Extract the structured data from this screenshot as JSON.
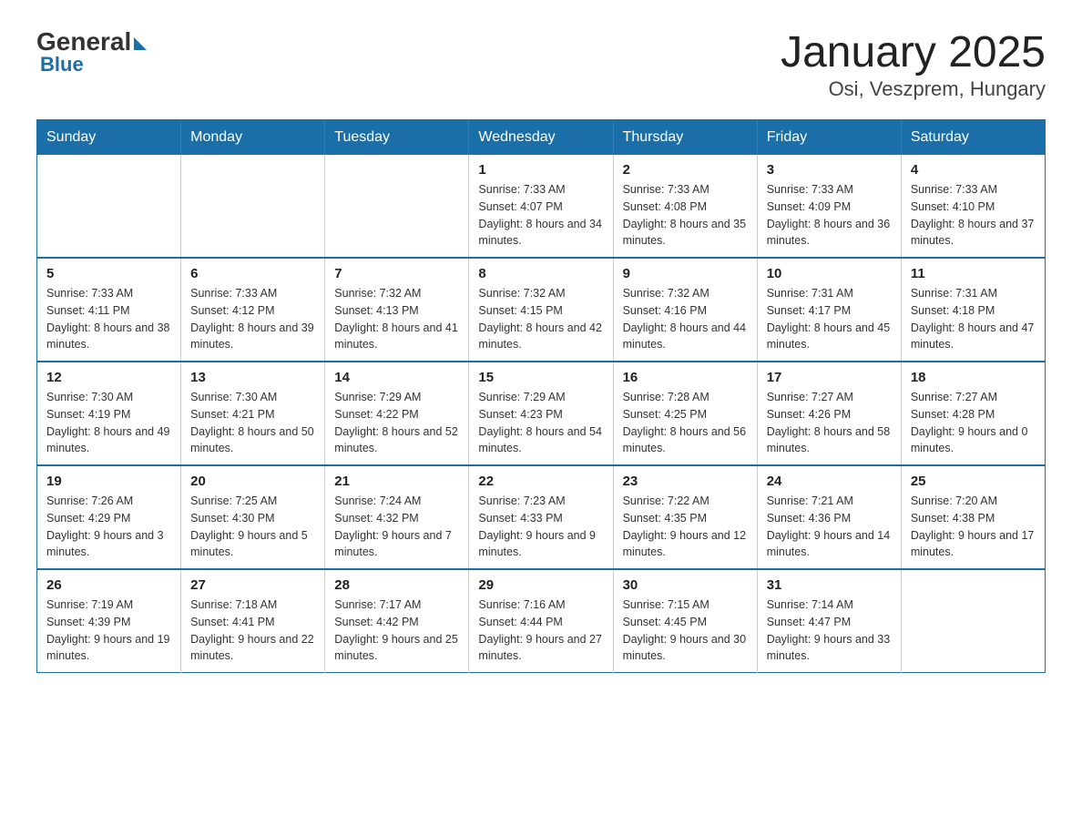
{
  "logo": {
    "general": "General",
    "blue": "Blue"
  },
  "title": "January 2025",
  "subtitle": "Osi, Veszprem, Hungary",
  "days_of_week": [
    "Sunday",
    "Monday",
    "Tuesday",
    "Wednesday",
    "Thursday",
    "Friday",
    "Saturday"
  ],
  "weeks": [
    [
      {
        "day": "",
        "info": ""
      },
      {
        "day": "",
        "info": ""
      },
      {
        "day": "",
        "info": ""
      },
      {
        "day": "1",
        "info": "Sunrise: 7:33 AM\nSunset: 4:07 PM\nDaylight: 8 hours\nand 34 minutes."
      },
      {
        "day": "2",
        "info": "Sunrise: 7:33 AM\nSunset: 4:08 PM\nDaylight: 8 hours\nand 35 minutes."
      },
      {
        "day": "3",
        "info": "Sunrise: 7:33 AM\nSunset: 4:09 PM\nDaylight: 8 hours\nand 36 minutes."
      },
      {
        "day": "4",
        "info": "Sunrise: 7:33 AM\nSunset: 4:10 PM\nDaylight: 8 hours\nand 37 minutes."
      }
    ],
    [
      {
        "day": "5",
        "info": "Sunrise: 7:33 AM\nSunset: 4:11 PM\nDaylight: 8 hours\nand 38 minutes."
      },
      {
        "day": "6",
        "info": "Sunrise: 7:33 AM\nSunset: 4:12 PM\nDaylight: 8 hours\nand 39 minutes."
      },
      {
        "day": "7",
        "info": "Sunrise: 7:32 AM\nSunset: 4:13 PM\nDaylight: 8 hours\nand 41 minutes."
      },
      {
        "day": "8",
        "info": "Sunrise: 7:32 AM\nSunset: 4:15 PM\nDaylight: 8 hours\nand 42 minutes."
      },
      {
        "day": "9",
        "info": "Sunrise: 7:32 AM\nSunset: 4:16 PM\nDaylight: 8 hours\nand 44 minutes."
      },
      {
        "day": "10",
        "info": "Sunrise: 7:31 AM\nSunset: 4:17 PM\nDaylight: 8 hours\nand 45 minutes."
      },
      {
        "day": "11",
        "info": "Sunrise: 7:31 AM\nSunset: 4:18 PM\nDaylight: 8 hours\nand 47 minutes."
      }
    ],
    [
      {
        "day": "12",
        "info": "Sunrise: 7:30 AM\nSunset: 4:19 PM\nDaylight: 8 hours\nand 49 minutes."
      },
      {
        "day": "13",
        "info": "Sunrise: 7:30 AM\nSunset: 4:21 PM\nDaylight: 8 hours\nand 50 minutes."
      },
      {
        "day": "14",
        "info": "Sunrise: 7:29 AM\nSunset: 4:22 PM\nDaylight: 8 hours\nand 52 minutes."
      },
      {
        "day": "15",
        "info": "Sunrise: 7:29 AM\nSunset: 4:23 PM\nDaylight: 8 hours\nand 54 minutes."
      },
      {
        "day": "16",
        "info": "Sunrise: 7:28 AM\nSunset: 4:25 PM\nDaylight: 8 hours\nand 56 minutes."
      },
      {
        "day": "17",
        "info": "Sunrise: 7:27 AM\nSunset: 4:26 PM\nDaylight: 8 hours\nand 58 minutes."
      },
      {
        "day": "18",
        "info": "Sunrise: 7:27 AM\nSunset: 4:28 PM\nDaylight: 9 hours\nand 0 minutes."
      }
    ],
    [
      {
        "day": "19",
        "info": "Sunrise: 7:26 AM\nSunset: 4:29 PM\nDaylight: 9 hours\nand 3 minutes."
      },
      {
        "day": "20",
        "info": "Sunrise: 7:25 AM\nSunset: 4:30 PM\nDaylight: 9 hours\nand 5 minutes."
      },
      {
        "day": "21",
        "info": "Sunrise: 7:24 AM\nSunset: 4:32 PM\nDaylight: 9 hours\nand 7 minutes."
      },
      {
        "day": "22",
        "info": "Sunrise: 7:23 AM\nSunset: 4:33 PM\nDaylight: 9 hours\nand 9 minutes."
      },
      {
        "day": "23",
        "info": "Sunrise: 7:22 AM\nSunset: 4:35 PM\nDaylight: 9 hours\nand 12 minutes."
      },
      {
        "day": "24",
        "info": "Sunrise: 7:21 AM\nSunset: 4:36 PM\nDaylight: 9 hours\nand 14 minutes."
      },
      {
        "day": "25",
        "info": "Sunrise: 7:20 AM\nSunset: 4:38 PM\nDaylight: 9 hours\nand 17 minutes."
      }
    ],
    [
      {
        "day": "26",
        "info": "Sunrise: 7:19 AM\nSunset: 4:39 PM\nDaylight: 9 hours\nand 19 minutes."
      },
      {
        "day": "27",
        "info": "Sunrise: 7:18 AM\nSunset: 4:41 PM\nDaylight: 9 hours\nand 22 minutes."
      },
      {
        "day": "28",
        "info": "Sunrise: 7:17 AM\nSunset: 4:42 PM\nDaylight: 9 hours\nand 25 minutes."
      },
      {
        "day": "29",
        "info": "Sunrise: 7:16 AM\nSunset: 4:44 PM\nDaylight: 9 hours\nand 27 minutes."
      },
      {
        "day": "30",
        "info": "Sunrise: 7:15 AM\nSunset: 4:45 PM\nDaylight: 9 hours\nand 30 minutes."
      },
      {
        "day": "31",
        "info": "Sunrise: 7:14 AM\nSunset: 4:47 PM\nDaylight: 9 hours\nand 33 minutes."
      },
      {
        "day": "",
        "info": ""
      }
    ]
  ]
}
